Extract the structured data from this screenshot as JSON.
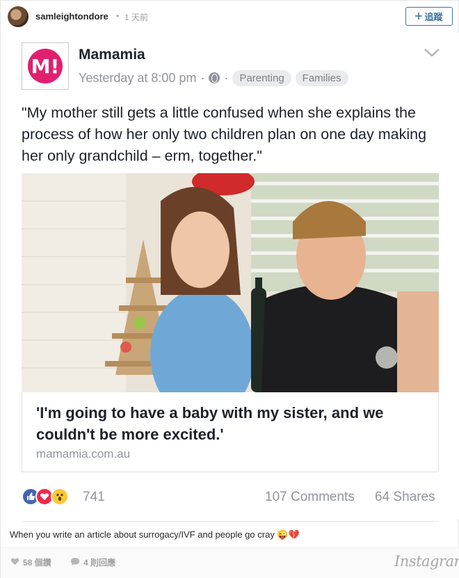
{
  "header": {
    "username": "samleightondore",
    "separator": "•",
    "time": "1 天前",
    "follow_icon": "plus-icon",
    "follow_label": "追蹤"
  },
  "fb_post": {
    "logo_text": "M!",
    "page_name": "Mamamia",
    "meta_time": "Yesterday at 8:00 pm",
    "meta_sep": "·",
    "tags": [
      "Parenting",
      "Families"
    ],
    "text": "\"My mother still gets a little confused when she explains the process of how her only two children plan on one day making her only grandchild – erm, together.\"",
    "link_title": "'I'm going to have a baby with my sister, and we couldn't be more excited.'",
    "link_domain": "mamamia.com.au",
    "reaction_count": "741",
    "comments": "107 Comments",
    "shares": "64 Shares"
  },
  "caption": "When you write an article about surrogacy/IVF and people go cray 😜💔",
  "footer": {
    "likes": "58 個讚",
    "comments": "4 則回應",
    "brand": "Instagram"
  },
  "colors": {
    "ig_blue": "#3f729b",
    "mamamia_pink": "#e0206f",
    "fb_like_blue": "#4267b2"
  }
}
